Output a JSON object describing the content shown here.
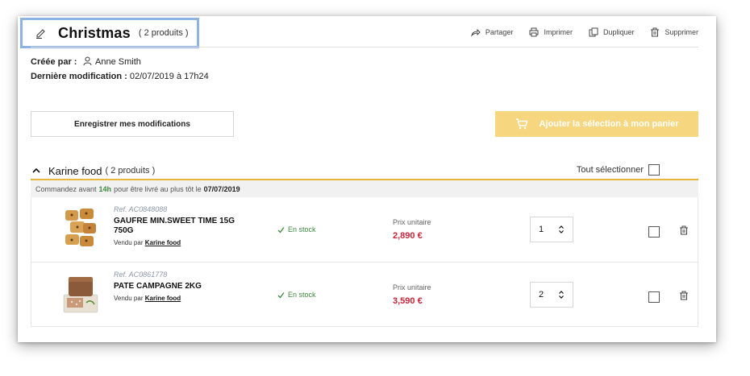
{
  "header": {
    "title": "Christmas",
    "count": "( 2 produits )",
    "actions": [
      {
        "label": "Partager",
        "icon": "share-icon"
      },
      {
        "label": "Imprimer",
        "icon": "print-icon"
      },
      {
        "label": "Dupliquer",
        "icon": "duplicate-icon"
      },
      {
        "label": "Supprimer",
        "icon": "trash-icon"
      }
    ]
  },
  "meta": {
    "created_label": "Créée par :",
    "created_by": "Anne Smith",
    "modified_label": "Dernière modification :",
    "modified_at": "02/07/2019 à 17h24"
  },
  "buttons": {
    "save": "Enregistrer mes modifications",
    "add_to_cart": "Ajouter la sélection à mon panier"
  },
  "supplier": {
    "name": "Karine food",
    "count": "( 2 produits )",
    "select_all": "Tout sélectionner",
    "delivery_prefix": "Commandez avant",
    "delivery_time": "14h",
    "delivery_middle": "pour être livré au plus tôt le",
    "delivery_date": "07/07/2019"
  },
  "products": [
    {
      "ref": "Ref. AC0848088",
      "name": "GAUFRE MIN.SWEET TIME 15G 750G",
      "seller_prefix": "Vendu par",
      "seller": "Karine food",
      "stock": "En stock",
      "price_label": "Prix unitaire",
      "price": "2,890 €",
      "quantity": "1"
    },
    {
      "ref": "Ref. AC0861778",
      "name": "PATE CAMPAGNE 2KG",
      "seller_prefix": "Vendu par",
      "seller": "Karine food",
      "stock": "En stock",
      "price_label": "Prix unitaire",
      "price": "3,590 €",
      "quantity": "2"
    }
  ],
  "colors": {
    "accent_yellow": "#f6d67e",
    "supplier_line": "#e8b63a",
    "price_red": "#c9253a",
    "stock_green": "#3d8a3d",
    "highlight_border": "#8db3e2"
  }
}
